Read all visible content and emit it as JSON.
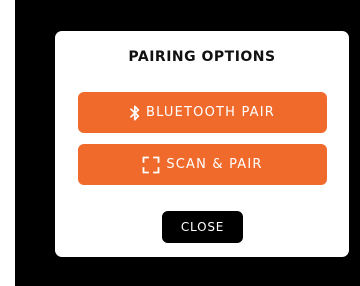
{
  "modal": {
    "title": "PAIRING OPTIONS",
    "buttons": [
      {
        "label": "BLUETOOTH PAIR",
        "icon": "bluetooth-icon"
      },
      {
        "label": "SCAN & PAIR",
        "icon": "scan-frame-icon"
      }
    ],
    "close_label": "CLOSE"
  },
  "colors": {
    "accent": "#ef6a2b",
    "backdrop": "#000000",
    "modal_bg": "#ffffff",
    "close_bg": "#000000"
  }
}
